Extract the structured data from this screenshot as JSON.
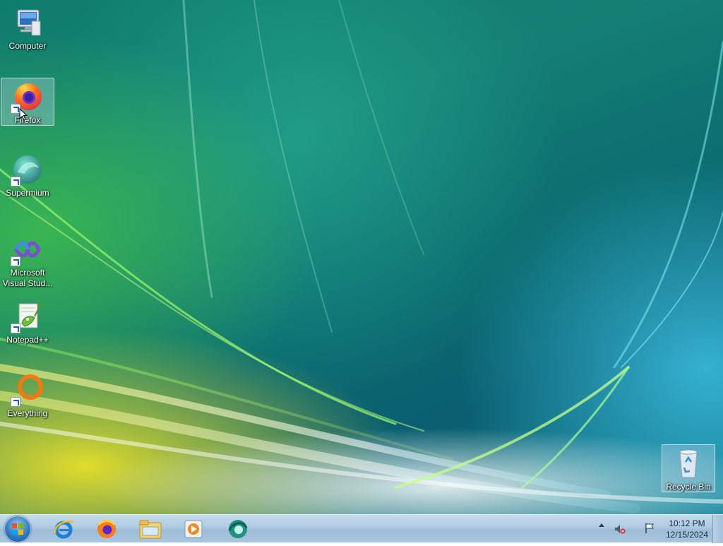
{
  "desktop": {
    "icons": [
      {
        "label": "Computer"
      },
      {
        "label": "Firefox"
      },
      {
        "label": "Supermium"
      },
      {
        "label": "Microsoft Visual Stud..."
      },
      {
        "label": "Notepad++"
      },
      {
        "label": "Everything"
      },
      {
        "label": "Recycle Bin"
      }
    ],
    "selected_icon": "Firefox"
  },
  "taskbar": {
    "pinned": [
      {
        "icon": "internet-explorer-icon"
      },
      {
        "icon": "firefox-icon"
      },
      {
        "icon": "file-explorer-icon"
      },
      {
        "icon": "media-player-icon"
      },
      {
        "icon": "supermium-icon"
      }
    ],
    "tray": {
      "icons": [
        "show-hidden-icons-chevron",
        "volume-muted-icon",
        "action-center-flag-icon"
      ],
      "time": "10:12 PM",
      "date": "12/15/2024"
    }
  },
  "colors": {
    "taskbar": "#a8c5dd",
    "desktop_teal": "#0f7d6e"
  }
}
